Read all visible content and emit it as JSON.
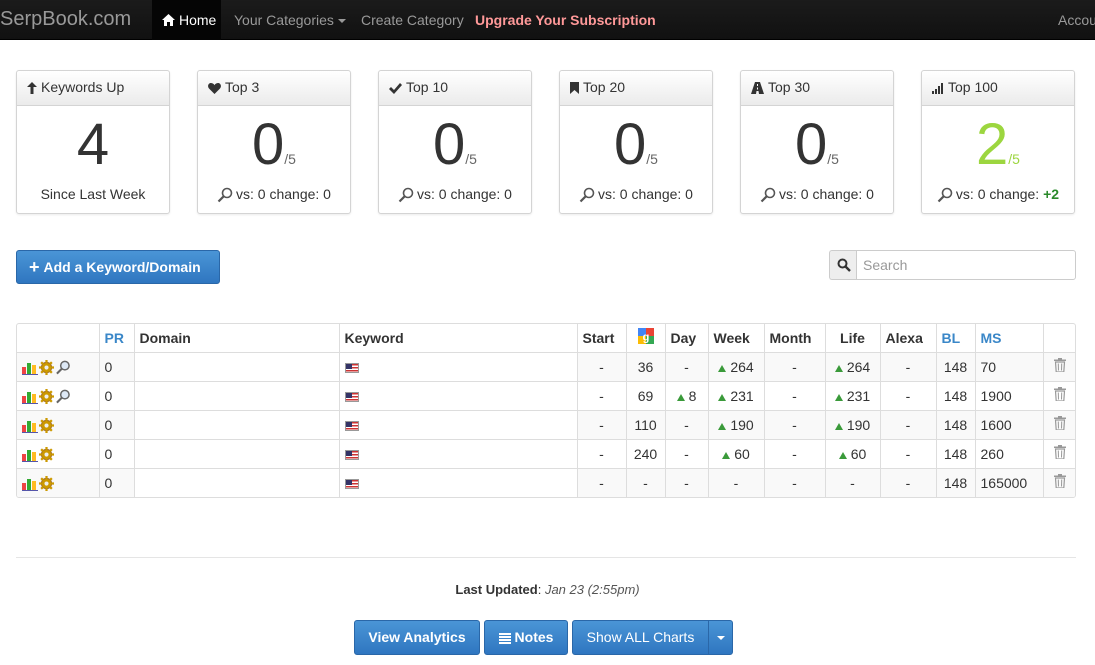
{
  "navbar": {
    "brand": "SerpBook.com",
    "home": "Home",
    "categories": "Your Categories",
    "create_category": "Create Category",
    "upgrade": "Upgrade Your Subscription",
    "account": "Accou"
  },
  "stats": [
    {
      "title": "Keywords Up",
      "icon": "arrow-up-icon",
      "value": "4",
      "denom": "",
      "foot": "Since Last Week"
    },
    {
      "title": "Top 3",
      "icon": "heart-icon",
      "value": "0",
      "denom": "/5",
      "foot": "vs: 0 change: 0"
    },
    {
      "title": "Top 10",
      "icon": "check-icon",
      "value": "0",
      "denom": "/5",
      "foot": "vs: 0 change: 0"
    },
    {
      "title": "Top 20",
      "icon": "bookmark-icon",
      "value": "0",
      "denom": "/5",
      "foot": "vs: 0 change: 0"
    },
    {
      "title": "Top 30",
      "icon": "road-icon",
      "value": "0",
      "denom": "/5",
      "foot": "vs: 0 change: 0"
    },
    {
      "title": "Top 100",
      "icon": "signal-icon",
      "value": "2",
      "denom": "/5",
      "foot": "vs: 0 change:",
      "change": "+2"
    }
  ],
  "add_button": "Add a Keyword/Domain",
  "search": {
    "placeholder": "Search"
  },
  "table": {
    "headers": {
      "pr": "PR",
      "domain": "Domain",
      "keyword": "Keyword",
      "start": "Start",
      "day": "Day",
      "week": "Week",
      "month": "Month",
      "life": "Life",
      "alexa": "Alexa",
      "bl": "BL",
      "ms": "MS"
    },
    "rows": [
      {
        "pr": "0",
        "start": "-",
        "google": "36",
        "day": "-",
        "week": "264",
        "month": "-",
        "life": "264",
        "alexa": "-",
        "bl": "148",
        "ms": "70"
      },
      {
        "pr": "0",
        "start": "-",
        "google": "69",
        "day": "8",
        "week": "231",
        "month": "-",
        "life": "231",
        "alexa": "-",
        "bl": "148",
        "ms": "1900"
      },
      {
        "pr": "0",
        "start": "-",
        "google": "110",
        "day": "-",
        "week": "190",
        "month": "-",
        "life": "190",
        "alexa": "-",
        "bl": "148",
        "ms": "1600"
      },
      {
        "pr": "0",
        "start": "-",
        "google": "240",
        "day": "-",
        "week": "60",
        "month": "-",
        "life": "60",
        "alexa": "-",
        "bl": "148",
        "ms": "260"
      },
      {
        "pr": "0",
        "start": "-",
        "google": "-",
        "day": "-",
        "week": "-",
        "month": "-",
        "life": "-",
        "alexa": "-",
        "bl": "148",
        "ms": "165000"
      }
    ]
  },
  "footer": {
    "updated_label": "Last Updated",
    "updated_value": "Jan 23 (2:55pm)",
    "view_analytics": "View Analytics",
    "notes": "Notes",
    "show_all_charts": "Show ALL Charts"
  }
}
